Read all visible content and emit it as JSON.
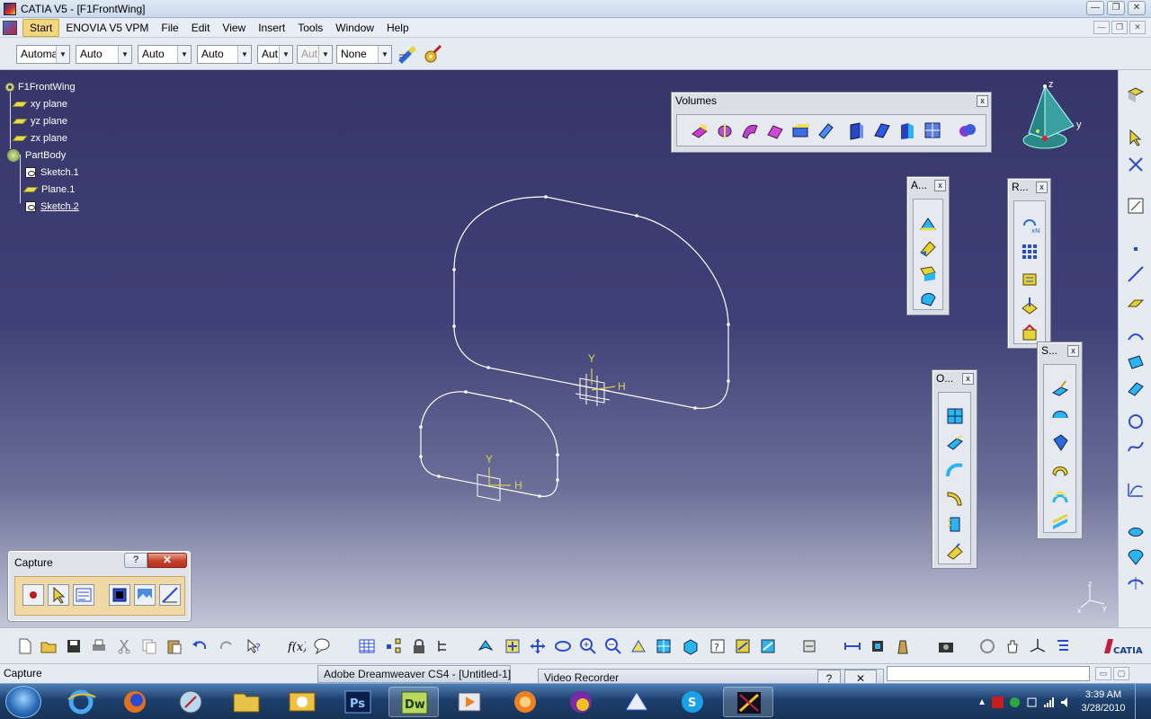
{
  "window": {
    "title": "CATIA V5 - [F1FrontWing]",
    "min": "—",
    "max": "❐",
    "close": "✕"
  },
  "menubar": {
    "items": [
      "Start",
      "ENOVIA V5 VPM",
      "File",
      "Edit",
      "View",
      "Insert",
      "Tools",
      "Window",
      "Help"
    ]
  },
  "toolbar1": {
    "combos": [
      "Automa",
      "Auto",
      "Auto",
      "Auto",
      "Aut",
      "Aut",
      "None"
    ]
  },
  "tree": {
    "root": "F1FrontWing",
    "items": [
      "xy plane",
      "yz plane",
      "zx plane",
      "PartBody",
      "Sketch.1",
      "Plane.1",
      "Sketch.2"
    ]
  },
  "panels": {
    "volumes": {
      "title": "Volumes",
      "close": "x"
    },
    "a": {
      "title": "A...",
      "close": "x"
    },
    "r": {
      "title": "R...",
      "close": "x"
    },
    "o": {
      "title": "O...",
      "close": "x"
    },
    "s": {
      "title": "S...",
      "close": "x"
    }
  },
  "capture": {
    "title": "Capture",
    "help": "?",
    "close": "✕"
  },
  "compass": {
    "z": "z",
    "y": "y",
    "x": "x"
  },
  "axis_labels": {
    "y": "Y",
    "h": "H"
  },
  "status": {
    "text": "Capture"
  },
  "taskbar": {
    "ghost1": "Adobe Dreamweaver CS4 - [Untitled-1]",
    "ghost2": "Video Recorder",
    "time": "3:39 AM",
    "date": "3/28/2010",
    "apps": [
      "Internet Explorer",
      "Firefox",
      "Safari",
      "Windows Explorer",
      "Outlook",
      "Ps",
      "Dw",
      "Media Player",
      "VLC",
      "Yahoo Messenger",
      "Chat",
      "Skype",
      "CATIA"
    ]
  },
  "colors": {
    "viewport_top": "#36366a",
    "viewport_bottom": "#c3c6d6",
    "sketch_line": "#ffffff",
    "axis": "#e0d050",
    "panel_bg": "#dcdfe6"
  }
}
